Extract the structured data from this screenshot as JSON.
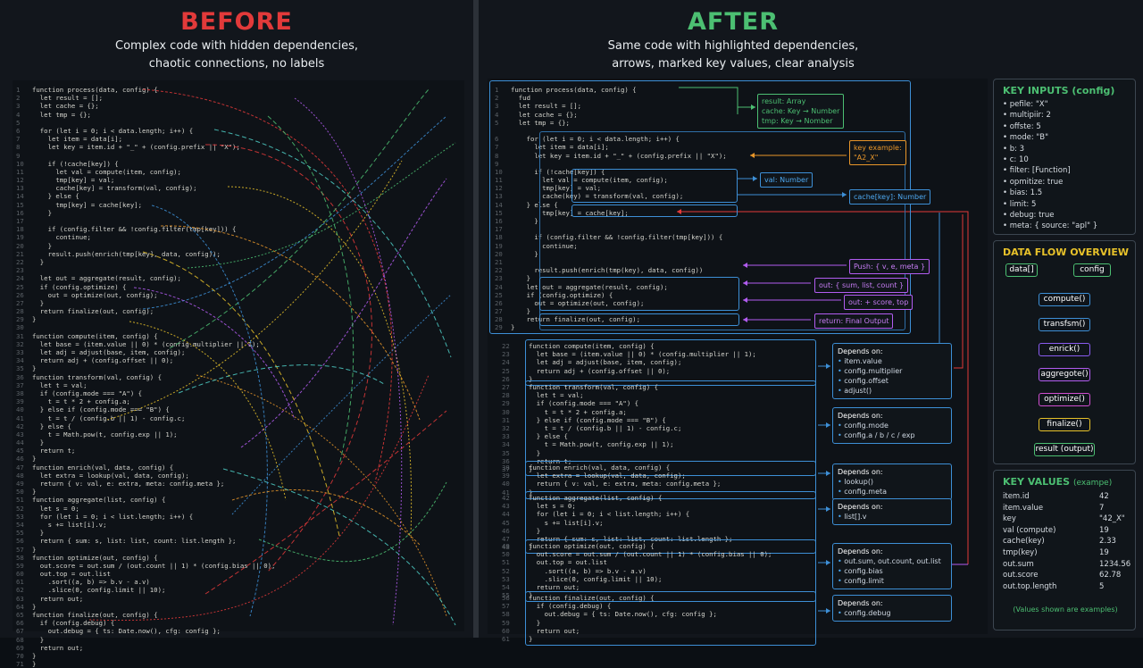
{
  "before": {
    "title": "BEFORE",
    "subtitle1": "Complex code with hidden dependencies,",
    "subtitle2": "chaotic connections, no labels"
  },
  "after": {
    "title": "AFTER",
    "subtitle1": "Same code with highlighted dependencies,",
    "subtitle2": "arrows, marked key values, clear analysis"
  },
  "colors": {
    "before_title": "#e23a3a",
    "after_title": "#4cbf72",
    "blue": "#3d8fd6",
    "green": "#4cbf72",
    "orange": "#e8962a",
    "purple": "#b25cf0",
    "red": "#e23a3a"
  },
  "code_left": [
    "function process(data, config) {",
    "  let result = [];",
    "  let cache = {};",
    "  let tmp = {};",
    "",
    "  for (let i = 0; i < data.length; i++) {",
    "    let item = data[i];",
    "    let key = item.id + \"_\" + (config.prefix || \"X\");",
    "",
    "    if (!cache[key]) {",
    "      let val = compute(item, config);",
    "      tmp[key] = val;",
    "      cache[key] = transform(val, config);",
    "    } else {",
    "      tmp[key] = cache[key];",
    "    }",
    "",
    "    if (config.filter && !config.filter(tmp[key])) {",
    "      continue;",
    "    }",
    "    result.push(enrich(tmp[key], data, config));",
    "  }",
    "",
    "  let out = aggregate(result, config);",
    "  if (config.optimize) {",
    "    out = optimize(out, config);",
    "  }",
    "  return finalize(out, config);",
    "}",
    "",
    "function compute(item, config) {",
    "  let base = (item.value || 0) * (config.multiplier || 1);",
    "  let adj = adjust(base, item, config);",
    "  return adj + (config.offset || 0);",
    "}",
    "function transform(val, config) {",
    "  let t = val;",
    "  if (config.mode === \"A\") {",
    "    t = t * 2 + config.a;",
    "  } else if (config.mode === \"B\") {",
    "    t = t / (config.b || 1) - config.c;",
    "  } else {",
    "    t = Math.pow(t, config.exp || 1);",
    "  }",
    "  return t;",
    "}",
    "function enrich(val, data, config) {",
    "  let extra = lookup(val, data, config);",
    "  return { v: val, e: extra, meta: config.meta };",
    "}",
    "function aggregate(list, config) {",
    "  let s = 0;",
    "  for (let i = 0; i < list.length; i++) {",
    "    s += list[i].v;",
    "  }",
    "  return { sum: s, list: list, count: list.length };",
    "}",
    "function optimize(out, config) {",
    "  out.score = out.sum / (out.count || 1) * (config.bias || 0);",
    "  out.top = out.list",
    "    .sort((a, b) => b.v - a.v)",
    "    .slice(0, config.limit || 10);",
    "  return out;",
    "}",
    "function finalize(out, config) {",
    "  if (config.debug) {",
    "    out.debug = { ts: Date.now(), cfg: config };",
    "  }",
    "  return out;",
    "}",
    "}"
  ],
  "code_main": [
    {
      "n": "1",
      "t": "function process(data, config) {"
    },
    {
      "n": "2",
      "t": "  fud"
    },
    {
      "n": "3",
      "t": "  let result = [];"
    },
    {
      "n": "4",
      "t": "  let cache = {};"
    },
    {
      "n": "5",
      "t": "  let tmp = {};"
    },
    {
      "n": "",
      "t": ""
    },
    {
      "n": "6",
      "t": "    for (let i = 0; i < data.length; i++) {"
    },
    {
      "n": "7",
      "t": "      let item = data[i];"
    },
    {
      "n": "8",
      "t": "      let key = item.id + \"_\" + (config.prefix || \"X\");"
    },
    {
      "n": "9",
      "t": ""
    },
    {
      "n": "10",
      "t": "      if (!cache[key]) {"
    },
    {
      "n": "11",
      "t": "        let val = compute(item, config);"
    },
    {
      "n": "12",
      "t": "        tmp[key] = val;"
    },
    {
      "n": "13",
      "t": "        cache(key) = transform(val, config);"
    },
    {
      "n": "14",
      "t": "    } else {"
    },
    {
      "n": "15",
      "t": "        tmp[key] = cache[key];"
    },
    {
      "n": "16",
      "t": "      }"
    },
    {
      "n": "17",
      "t": ""
    },
    {
      "n": "18",
      "t": "      if (config.filter && !config.filter(tmp[key])) {"
    },
    {
      "n": "19",
      "t": "        continue;"
    },
    {
      "n": "20",
      "t": "      }"
    },
    {
      "n": "21",
      "t": ""
    },
    {
      "n": "22",
      "t": "      result.push(enrich(tmp(key), data, config))"
    },
    {
      "n": "23",
      "t": "    }"
    },
    {
      "n": "24",
      "t": "    let out = aggregate(result, config);"
    },
    {
      "n": "25",
      "t": "    if (config.optimize) {"
    },
    {
      "n": "26",
      "t": "      out = optimize(out, config);"
    },
    {
      "n": "27",
      "t": "    }"
    },
    {
      "n": "28",
      "t": "    return finalize(out, config);"
    },
    {
      "n": "29",
      "t": "}"
    }
  ],
  "functions": [
    {
      "lines": [
        [
          "22",
          "function compute(item, config) {"
        ],
        [
          "23",
          "  let base = (item.value || 0) * (config.multiplier || 1);"
        ],
        [
          "24",
          "  let adj = adjust(base, item, config);"
        ],
        [
          "25",
          "  return adj + (config.offset || 0);"
        ],
        [
          "26",
          "}"
        ]
      ],
      "dep_title": "Depends on:",
      "deps": [
        "item.value",
        "config.multiplier",
        "config.offset",
        "adjust()"
      ]
    },
    {
      "lines": [
        [
          "27",
          "function transform(val, config) {"
        ],
        [
          "28",
          "  let t = val;"
        ],
        [
          "29",
          "  if (config.mode === \"A\") {"
        ],
        [
          "30",
          "    t = t * 2 + config.a;"
        ],
        [
          "31",
          "  } else if (config.mode === \"B\") {"
        ],
        [
          "32",
          "    t = t / (config.b || 1) - config.c;"
        ],
        [
          "33",
          "  } else {"
        ],
        [
          "34",
          "    t = Math.pow(t, config.exp || 1);"
        ],
        [
          "35",
          "  }"
        ],
        [
          "36",
          "  return t;"
        ],
        [
          "37",
          "}"
        ]
      ],
      "dep_title": "Depends on:",
      "deps": [
        "config.mode",
        "config.a / b / c / exp"
      ]
    },
    {
      "lines": [
        [
          "38",
          "function enrich(val, data, config) {"
        ],
        [
          "39",
          "  let extra = lookup(val, data, config);"
        ],
        [
          "40",
          "  return { v: val, e: extra, meta: config.meta };"
        ],
        [
          "41",
          "}"
        ]
      ],
      "dep_title": "Depends on:",
      "deps": [
        "lookup()",
        "config.meta"
      ]
    },
    {
      "lines": [
        [
          "42",
          "function aggregate(list, config) {"
        ],
        [
          "43",
          "  let s = 0;"
        ],
        [
          "44",
          "  for (let i = 0; i < list.length; i++) {"
        ],
        [
          "45",
          "    s += list[i].v;"
        ],
        [
          "46",
          "  }"
        ],
        [
          "47",
          "  return { sum: s, list: list, count: list.length };"
        ],
        [
          "48",
          "}"
        ]
      ],
      "dep_title": "Depends on:",
      "deps": [
        "list[].v"
      ]
    },
    {
      "lines": [
        [
          "49",
          "function optimize(out, config) {"
        ],
        [
          "50",
          "  out.score = out.sum / (out.count || 1) * (config.bias || 0);"
        ],
        [
          "51",
          "  out.top = out.list"
        ],
        [
          "52",
          "    .sort((a, b) => b.v - a.v)"
        ],
        [
          "53",
          "    .slice(0, config.limit || 10);"
        ],
        [
          "54",
          "  return out;"
        ],
        [
          "55",
          "}"
        ]
      ],
      "dep_title": "Depends on:",
      "deps": [
        "out.sum, out.count, out.list",
        "config.bias",
        "config.limit"
      ]
    },
    {
      "lines": [
        [
          "56",
          "function finalize(out, config) {"
        ],
        [
          "57",
          "  if (config.debug) {"
        ],
        [
          "58",
          "    out.debug = { ts: Date.now(), cfg: config };"
        ],
        [
          "59",
          "  }"
        ],
        [
          "60",
          "  return out;"
        ],
        [
          "61",
          "}"
        ]
      ],
      "dep_title": "Depends on:",
      "deps": [
        "config.debug"
      ]
    }
  ],
  "annotations": {
    "result": [
      "result: Array",
      "cache: Key → Number",
      "tmp: Key → Nomber"
    ],
    "key_example": [
      "key example:",
      "\"A2_X\""
    ],
    "val": "val: Number",
    "cache_key": "cache[key]: Number",
    "push": "Push: { v, e, meta }",
    "out_sum": "out: { sum, list, count }",
    "out_score": "out: + score, top",
    "return_final": "return: Final Output"
  },
  "key_inputs": {
    "title": "KEY INPUTS (config)",
    "items": [
      "pefile: \"X\"",
      "multipiir: 2",
      "offste: 5",
      "mode: \"B\"",
      "b: 3",
      "c: 10",
      "filter: [Function]",
      "opmitize: true",
      "bias: 1.5",
      "limit: 5",
      "debug: true",
      "meta: { source: \"apl\" }"
    ]
  },
  "data_flow": {
    "title": "DATA FLOW OVERVIEW",
    "inputs": [
      "data[]",
      "config"
    ],
    "steps": [
      "compute()",
      "transfsm()",
      "enrick()",
      "aggregote()",
      "optimize()",
      "finalize()",
      "result (output)"
    ]
  },
  "key_values": {
    "title": "KEY VALUES",
    "title_note": "(exampe)",
    "rows": [
      [
        "item.id",
        "42"
      ],
      [
        "item.value",
        "7"
      ],
      [
        "key",
        "\"42_X\""
      ],
      [
        "val (compute)",
        "19"
      ],
      [
        "cache(key)",
        "2.33"
      ],
      [
        "tmp(key)",
        "19"
      ],
      [
        "out.sum",
        "1234.56"
      ],
      [
        "out.score",
        "62.78"
      ],
      [
        "out.top.length",
        "5"
      ]
    ],
    "note": "(Values shown are examples)"
  }
}
